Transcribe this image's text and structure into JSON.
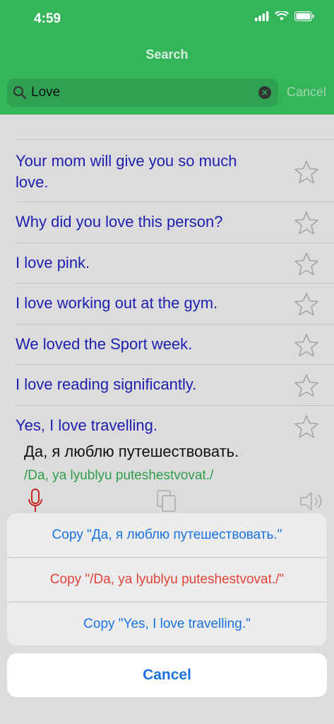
{
  "status": {
    "time": "4:59"
  },
  "nav": {
    "title": "Search"
  },
  "search": {
    "value": "Love",
    "cancel_label": "Cancel"
  },
  "results": [
    {
      "text": "Your mom will give you so much love."
    },
    {
      "text": "Why did you love this person?"
    },
    {
      "text": "I love pink."
    },
    {
      "text": "I love working out at the gym."
    },
    {
      "text": "We loved the Sport week."
    },
    {
      "text": "I love reading significantly."
    },
    {
      "text": "Yes, I love travelling."
    }
  ],
  "detail": {
    "russian": "Да, я люблю путешествовать.",
    "transliteration": "/Da, ya lyublyu puteshestvovat./"
  },
  "action_sheet": {
    "options": [
      {
        "label": "Copy \"Да, я люблю путешествовать.\"",
        "color": "#1a73e0"
      },
      {
        "label": "Copy \"/Da, ya lyublyu puteshestvovat./\"",
        "color": "#e5433a"
      },
      {
        "label": "Copy \"Yes, I love travelling.\"",
        "color": "#1a73e0"
      }
    ],
    "cancel_label": "Cancel"
  },
  "colors": {
    "header": "#34b55a",
    "link_text": "#1d1fb0",
    "transliteration": "#2f9e4b",
    "accent": "#1a73e0",
    "destructive": "#e5433a"
  }
}
